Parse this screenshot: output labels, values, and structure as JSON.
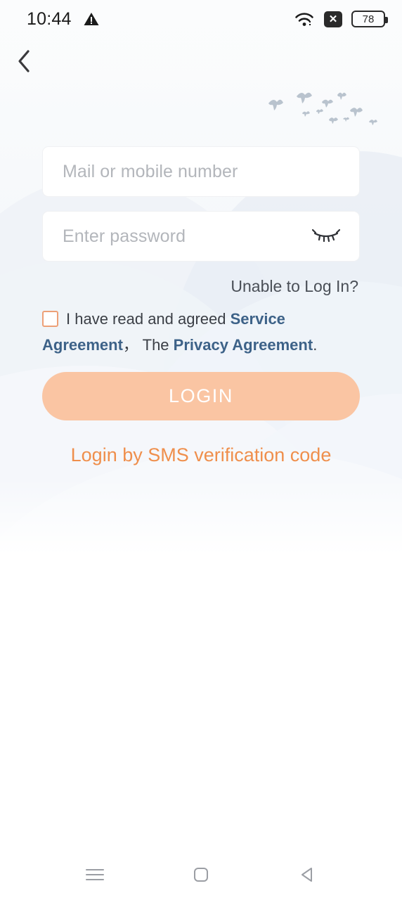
{
  "statusbar": {
    "time": "10:44",
    "warning_icon": "warning-triangle-icon",
    "wifi_icon": "wifi-icon",
    "block_icon": "x-box-icon",
    "block_glyph": "✕",
    "battery_level": "78"
  },
  "nav": {
    "back_icon": "back-chevron-icon"
  },
  "decor": {
    "birds_icon": "birds-flock-icon",
    "mountains_icon": "mountain-background-icon"
  },
  "form": {
    "account_placeholder": "Mail or mobile number",
    "account_value": "",
    "password_placeholder": "Enter password",
    "password_value": "",
    "password_toggle_icon": "eye-off-icon",
    "unable_login_label": "Unable to Log In?",
    "agreement": {
      "prefix": "I have read and agreed ",
      "service_link": "Service Agreement",
      "separator": "， The ",
      "privacy_link": "Privacy Agreement",
      "suffix": ".",
      "checked": false
    },
    "login_label": "LOGIN",
    "sms_login_label": "Login by SMS verification code"
  },
  "colors": {
    "accent_orange": "#ef8f4c",
    "login_button": "#fac5a3",
    "checkbox_border": "#eda077",
    "link_blue": "#3d6288",
    "placeholder_gray": "#b3b6bb"
  },
  "androidnav": {
    "recents_icon": "menu-lines-icon",
    "home_icon": "home-square-icon",
    "back_icon": "back-triangle-icon"
  }
}
